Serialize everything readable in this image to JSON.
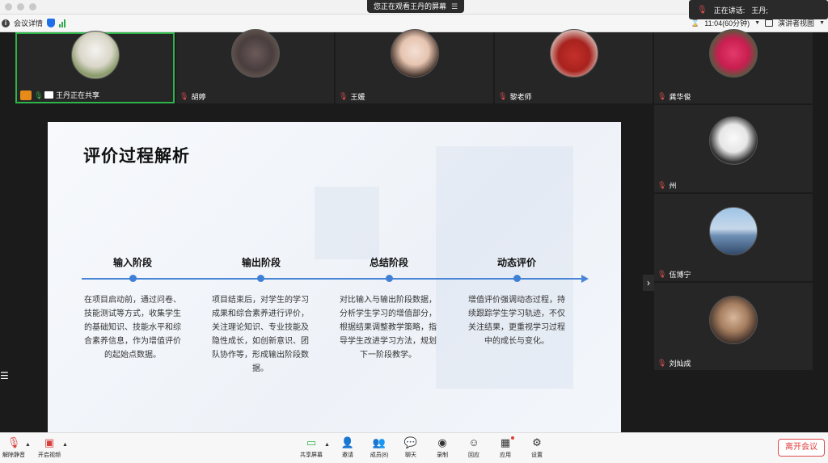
{
  "window": {
    "sharing_banner": "您正在观看王丹的屏幕"
  },
  "infobar": {
    "meeting_details": "会议详情",
    "timer": "11:04(60分钟)",
    "view_mode": "演讲者视图"
  },
  "speaking": {
    "label": "正在讲话:",
    "name": "王丹;"
  },
  "participants": [
    {
      "name": "王丹正在共享",
      "sharing": true
    },
    {
      "name": "胡婷"
    },
    {
      "name": "王媛"
    },
    {
      "name": "黎老师"
    },
    {
      "name": "龚华俊"
    },
    {
      "name": "州"
    },
    {
      "name": "伍博宁"
    },
    {
      "name": "刘灿成"
    }
  ],
  "slide": {
    "title": "评价过程解析",
    "stages": [
      {
        "title": "输入阶段",
        "desc": "在项目启动前，通过问卷、技能测试等方式，收集学生的基础知识、技能水平和综合素养信息，作为增值评价的起始点数据。"
      },
      {
        "title": "输出阶段",
        "desc": "项目结束后，对学生的学习成果和综合素养进行评价，关注理论知识、专业技能及隐性成长，如创新意识、团队协作等，形成输出阶段数据。"
      },
      {
        "title": "总结阶段",
        "desc": "对比输入与输出阶段数据，分析学生学习的增值部分，根据结果调整教学策略，指导学生改进学习方法，规划下一阶段教学。"
      },
      {
        "title": "动态评价",
        "desc": "增值评价强调动态过程，持续跟踪学生学习轨迹，不仅关注结果，更重视学习过程中的成长与变化。"
      }
    ]
  },
  "toolbar": {
    "unmute": "解除静音",
    "start_video": "开启视频",
    "share_screen": "共享屏幕",
    "invite": "邀请",
    "members": "成员(8)",
    "chat": "聊天",
    "record": "录制",
    "reactions": "回应",
    "apps": "应用",
    "settings": "设置",
    "leave": "离开会议"
  },
  "colors": {
    "accent": "#4a86d8",
    "active_border": "#2fb44a",
    "leave": "#e03a3a",
    "muted_mic": "#d85050"
  }
}
